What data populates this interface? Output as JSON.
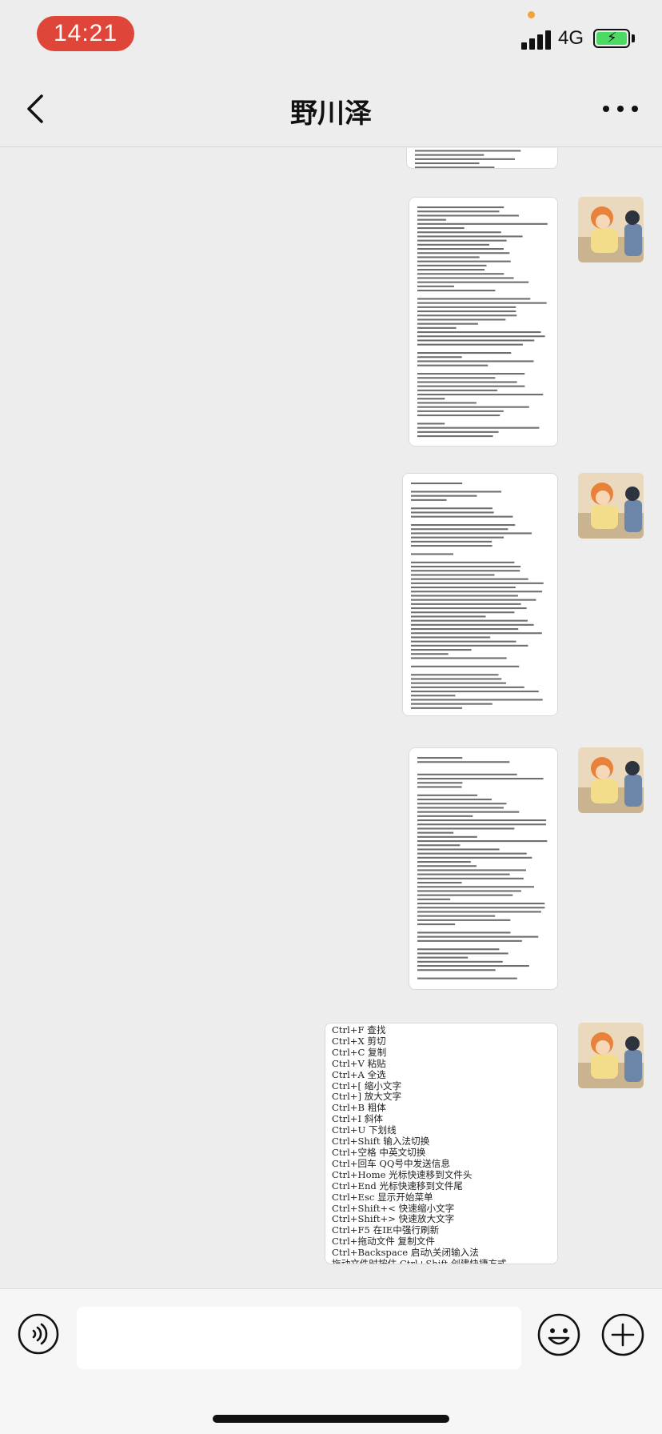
{
  "status_bar": {
    "time": "14:21",
    "network": "4G"
  },
  "nav": {
    "title": "野川泽"
  },
  "messages": {
    "text_message_lines": [
      "Ctrl+F 查找",
      "Ctrl+X 剪切",
      "Ctrl+C 复制",
      "Ctrl+V 粘贴",
      "Ctrl+A 全选",
      "Ctrl+[ 缩小文字",
      "Ctrl+] 放大文字",
      "Ctrl+B 粗体",
      "Ctrl+I 斜体",
      "Ctrl+U 下划线",
      "Ctrl+Shift 输入法切换",
      "Ctrl+空格 中英文切换",
      "Ctrl+回车 QQ号中发送信息",
      "Ctrl+Home 光标快速移到文件头",
      "Ctrl+End 光标快速移到文件尾",
      "Ctrl+Esc 显示开始菜单",
      "Ctrl+Shift+< 快速缩小文字",
      "Ctrl+Shift+> 快速放大文字",
      "Ctrl+F5 在IE中强行刷新",
      "Ctrl+拖动文件 复制文件",
      "Ctrl+Backspace 启动\\关闭输入法",
      "拖动文件时按住 Ctrl+Shift 创建快捷方式"
    ]
  },
  "colors": {
    "background": "#ededed",
    "time_pill": "#e0453a",
    "battery_fill": "#4cd964",
    "bubble": "#ffffff"
  },
  "icons": {
    "back": "chevron-left-icon",
    "more": "more-dots-icon",
    "voice": "voice-icon",
    "emoji": "emoji-icon",
    "plus": "plus-icon"
  }
}
